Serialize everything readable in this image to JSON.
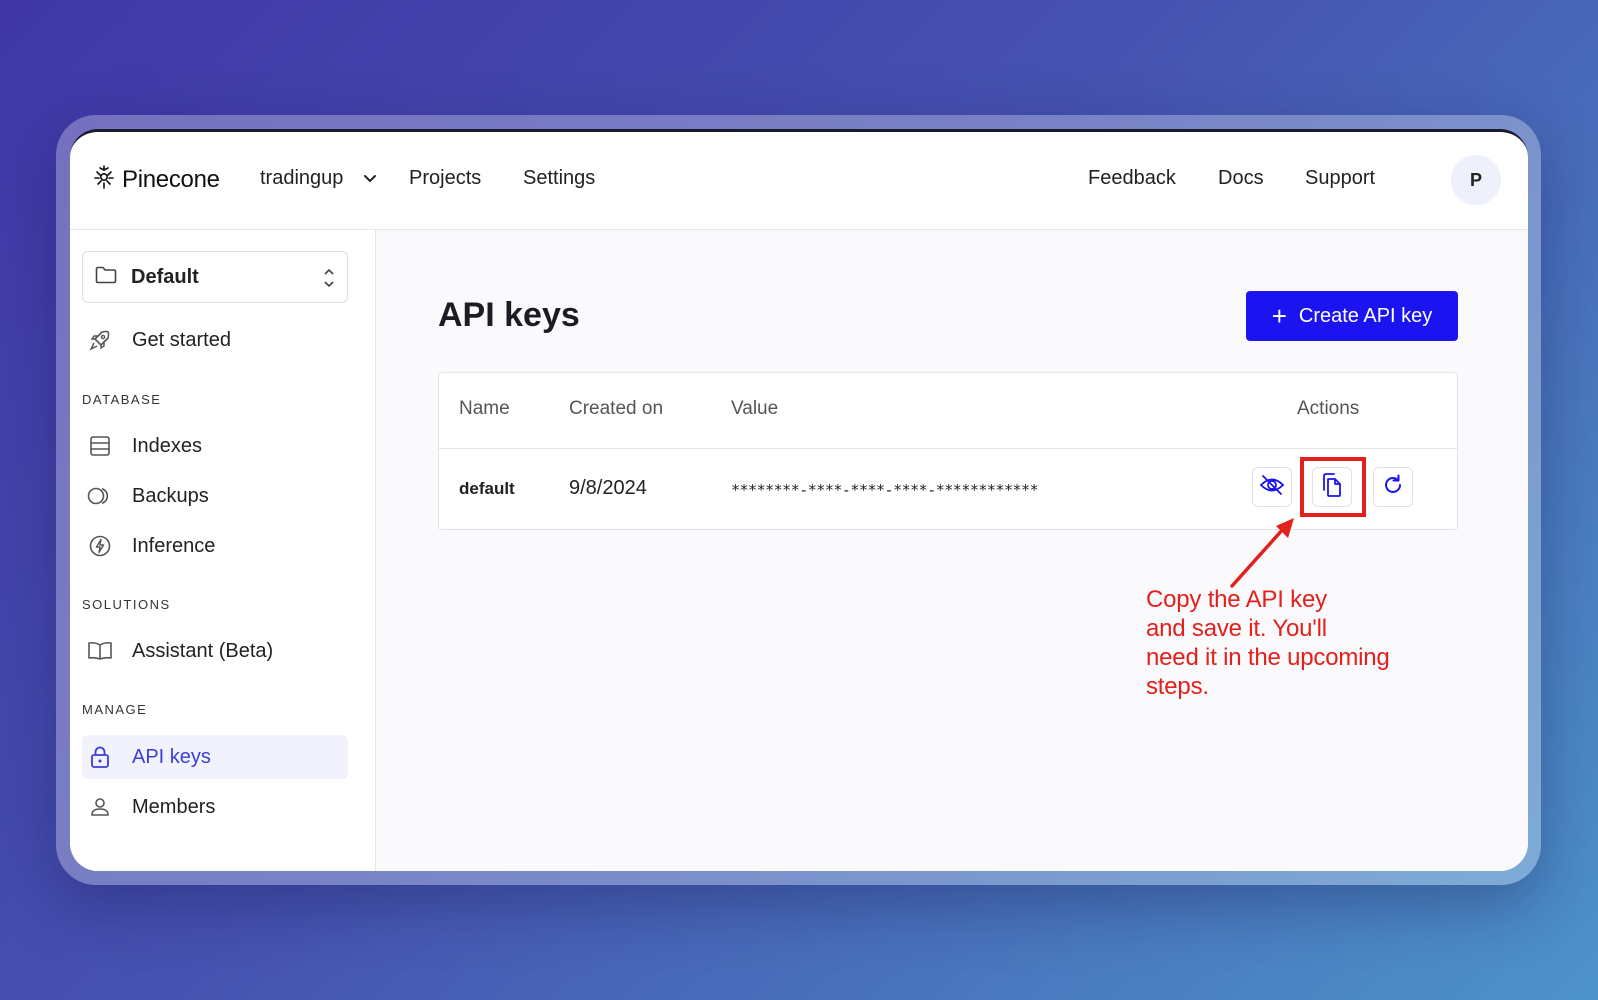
{
  "app": {
    "brand": "Pinecone",
    "org_selector": "tradingup",
    "nav": [
      "Projects",
      "Settings"
    ],
    "nav_right": [
      "Feedback",
      "Docs",
      "Support"
    ],
    "avatar_initial": "P"
  },
  "sidebar": {
    "project": "Default",
    "get_started": "Get started",
    "sections": {
      "database": "DATABASE",
      "solutions": "SOLUTIONS",
      "manage": "MANAGE"
    },
    "database_items": [
      "Indexes",
      "Backups",
      "Inference"
    ],
    "solutions_items": [
      "Assistant (Beta)"
    ],
    "manage_items": [
      "API keys",
      "Members"
    ],
    "active_item": "API keys"
  },
  "main": {
    "title": "API keys",
    "create_button": "Create API key",
    "table": {
      "columns": [
        "Name",
        "Created on",
        "Value",
        "Actions"
      ],
      "rows": [
        {
          "name": "default",
          "created_on": "9/8/2024",
          "value": "********-****-****-****-************"
        }
      ]
    }
  },
  "annotation": {
    "lines": [
      "Copy the API key",
      "and save it. You'll",
      "need it in the upcoming",
      "steps."
    ],
    "color": "#e3201b"
  },
  "colors": {
    "accent": "#1b14f0",
    "active_nav_text": "#3b3fd8"
  }
}
